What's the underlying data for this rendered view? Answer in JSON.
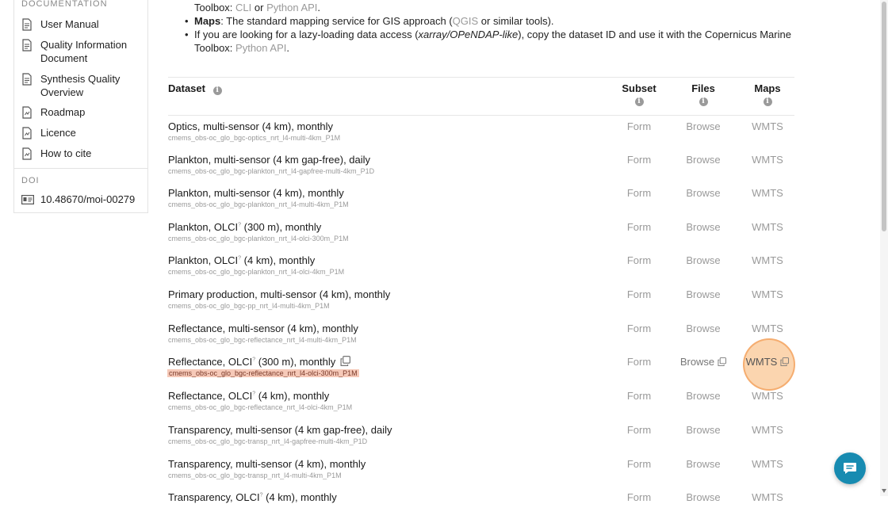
{
  "sidebar": {
    "documentation_heading": "DOCUMENTATION",
    "items": [
      {
        "label": "User Manual",
        "icon": "document-icon"
      },
      {
        "label": "Quality Information Document",
        "icon": "document-icon"
      },
      {
        "label": "Synthesis Quality Overview",
        "icon": "document-icon"
      },
      {
        "label": "Roadmap",
        "icon": "document-icon"
      },
      {
        "label": "Licence",
        "icon": "document-icon"
      },
      {
        "label": "How to cite",
        "icon": "document-icon"
      }
    ],
    "doi_heading": "DOI",
    "doi_value": "10.48670/moi-00279"
  },
  "intro": {
    "line1_pre": "Toolbox: ",
    "line1_cli": "CLI",
    "line1_or": " or ",
    "line1_api": "Python API",
    "line1_end": ".",
    "maps_label": "Maps",
    "maps_text_pre": ": The standard mapping service for GIS approach (",
    "maps_qgis": "QGIS",
    "maps_text_post": " or similar tools).",
    "lazy_pre": "If you are looking for a lazy-loading data access (",
    "lazy_italic": "xarray/OPeNDAP-like",
    "lazy_post": "), copy the dataset ID and use it with the Copernicus Marine",
    "lazy_line2_pre": "Toolbox: ",
    "lazy_line2_api": "Python API",
    "lazy_line2_end": "."
  },
  "table": {
    "headers": {
      "dataset": "Dataset",
      "subset": "Subset",
      "files": "Files",
      "maps": "Maps"
    },
    "rows": [
      {
        "name": "Optics, multi-sensor (4 km), monthly",
        "code": "cmems_obs-oc_glo_bgc-optics_nrt_l4-multi-4km_P1M",
        "subset": "Form",
        "files": "Browse",
        "maps": "WMTS"
      },
      {
        "name": "Plankton, multi-sensor (4 km gap-free), daily",
        "code": "cmems_obs-oc_glo_bgc-plankton_nrt_l4-gapfree-multi-4km_P1D",
        "subset": "Form",
        "files": "Browse",
        "maps": "WMTS"
      },
      {
        "name": "Plankton, multi-sensor (4 km), monthly",
        "code": "cmems_obs-oc_glo_bgc-plankton_nrt_l4-multi-4km_P1M",
        "subset": "Form",
        "files": "Browse",
        "maps": "WMTS"
      },
      {
        "name_pre": "Plankton, OLCI",
        "sup": "?",
        "name_post": " (300 m), monthly",
        "code": "cmems_obs-oc_glo_bgc-plankton_nrt_l4-olci-300m_P1M",
        "subset": "Form",
        "files": "Browse",
        "maps": "WMTS"
      },
      {
        "name_pre": "Plankton, OLCI",
        "sup": "?",
        "name_post": " (4 km), monthly",
        "code": "cmems_obs-oc_glo_bgc-plankton_nrt_l4-olci-4km_P1M",
        "subset": "Form",
        "files": "Browse",
        "maps": "WMTS"
      },
      {
        "name": "Primary production, multi-sensor (4 km), monthly",
        "code": "cmems_obs-oc_glo_bgc-pp_nrt_l4-multi-4km_P1M",
        "subset": "Form",
        "files": "Browse",
        "maps": "WMTS"
      },
      {
        "name": "Reflectance, multi-sensor (4 km), monthly",
        "code": "cmems_obs-oc_glo_bgc-reflectance_nrt_l4-multi-4km_P1M",
        "subset": "Form",
        "files": "Browse",
        "maps": "WMTS"
      },
      {
        "name_pre": "Reflectance, OLCI",
        "sup": "?",
        "name_post": " (300 m), monthly",
        "code": "cmems_obs-oc_glo_bgc-reflectance_nrt_l4-olci-300m_P1M",
        "subset": "Form",
        "files": "Browse",
        "maps": "WMTS",
        "hover": true
      },
      {
        "name_pre": "Reflectance, OLCI",
        "sup": "?",
        "name_post": " (4 km), monthly",
        "code": "cmems_obs-oc_glo_bgc-reflectance_nrt_l4-olci-4km_P1M",
        "subset": "Form",
        "files": "Browse",
        "maps": "WMTS"
      },
      {
        "name": "Transparency, multi-sensor (4 km gap-free), daily",
        "code": "cmems_obs-oc_glo_bgc-transp_nrt_l4-gapfree-multi-4km_P1D",
        "subset": "Form",
        "files": "Browse",
        "maps": "WMTS"
      },
      {
        "name": "Transparency, multi-sensor (4 km), monthly",
        "code": "cmems_obs-oc_glo_bgc-transp_nrt_l4-multi-4km_P1M",
        "subset": "Form",
        "files": "Browse",
        "maps": "WMTS"
      },
      {
        "name_pre": "Transparency, OLCI",
        "sup": "?",
        "name_post": " (4 km), monthly",
        "code": "",
        "subset": "Form",
        "files": "Browse",
        "maps": "WMTS"
      }
    ]
  },
  "colors": {
    "highlight": "#f6c9b8",
    "click_marker": "#f7b26e",
    "chat_button": "#178bb1"
  }
}
